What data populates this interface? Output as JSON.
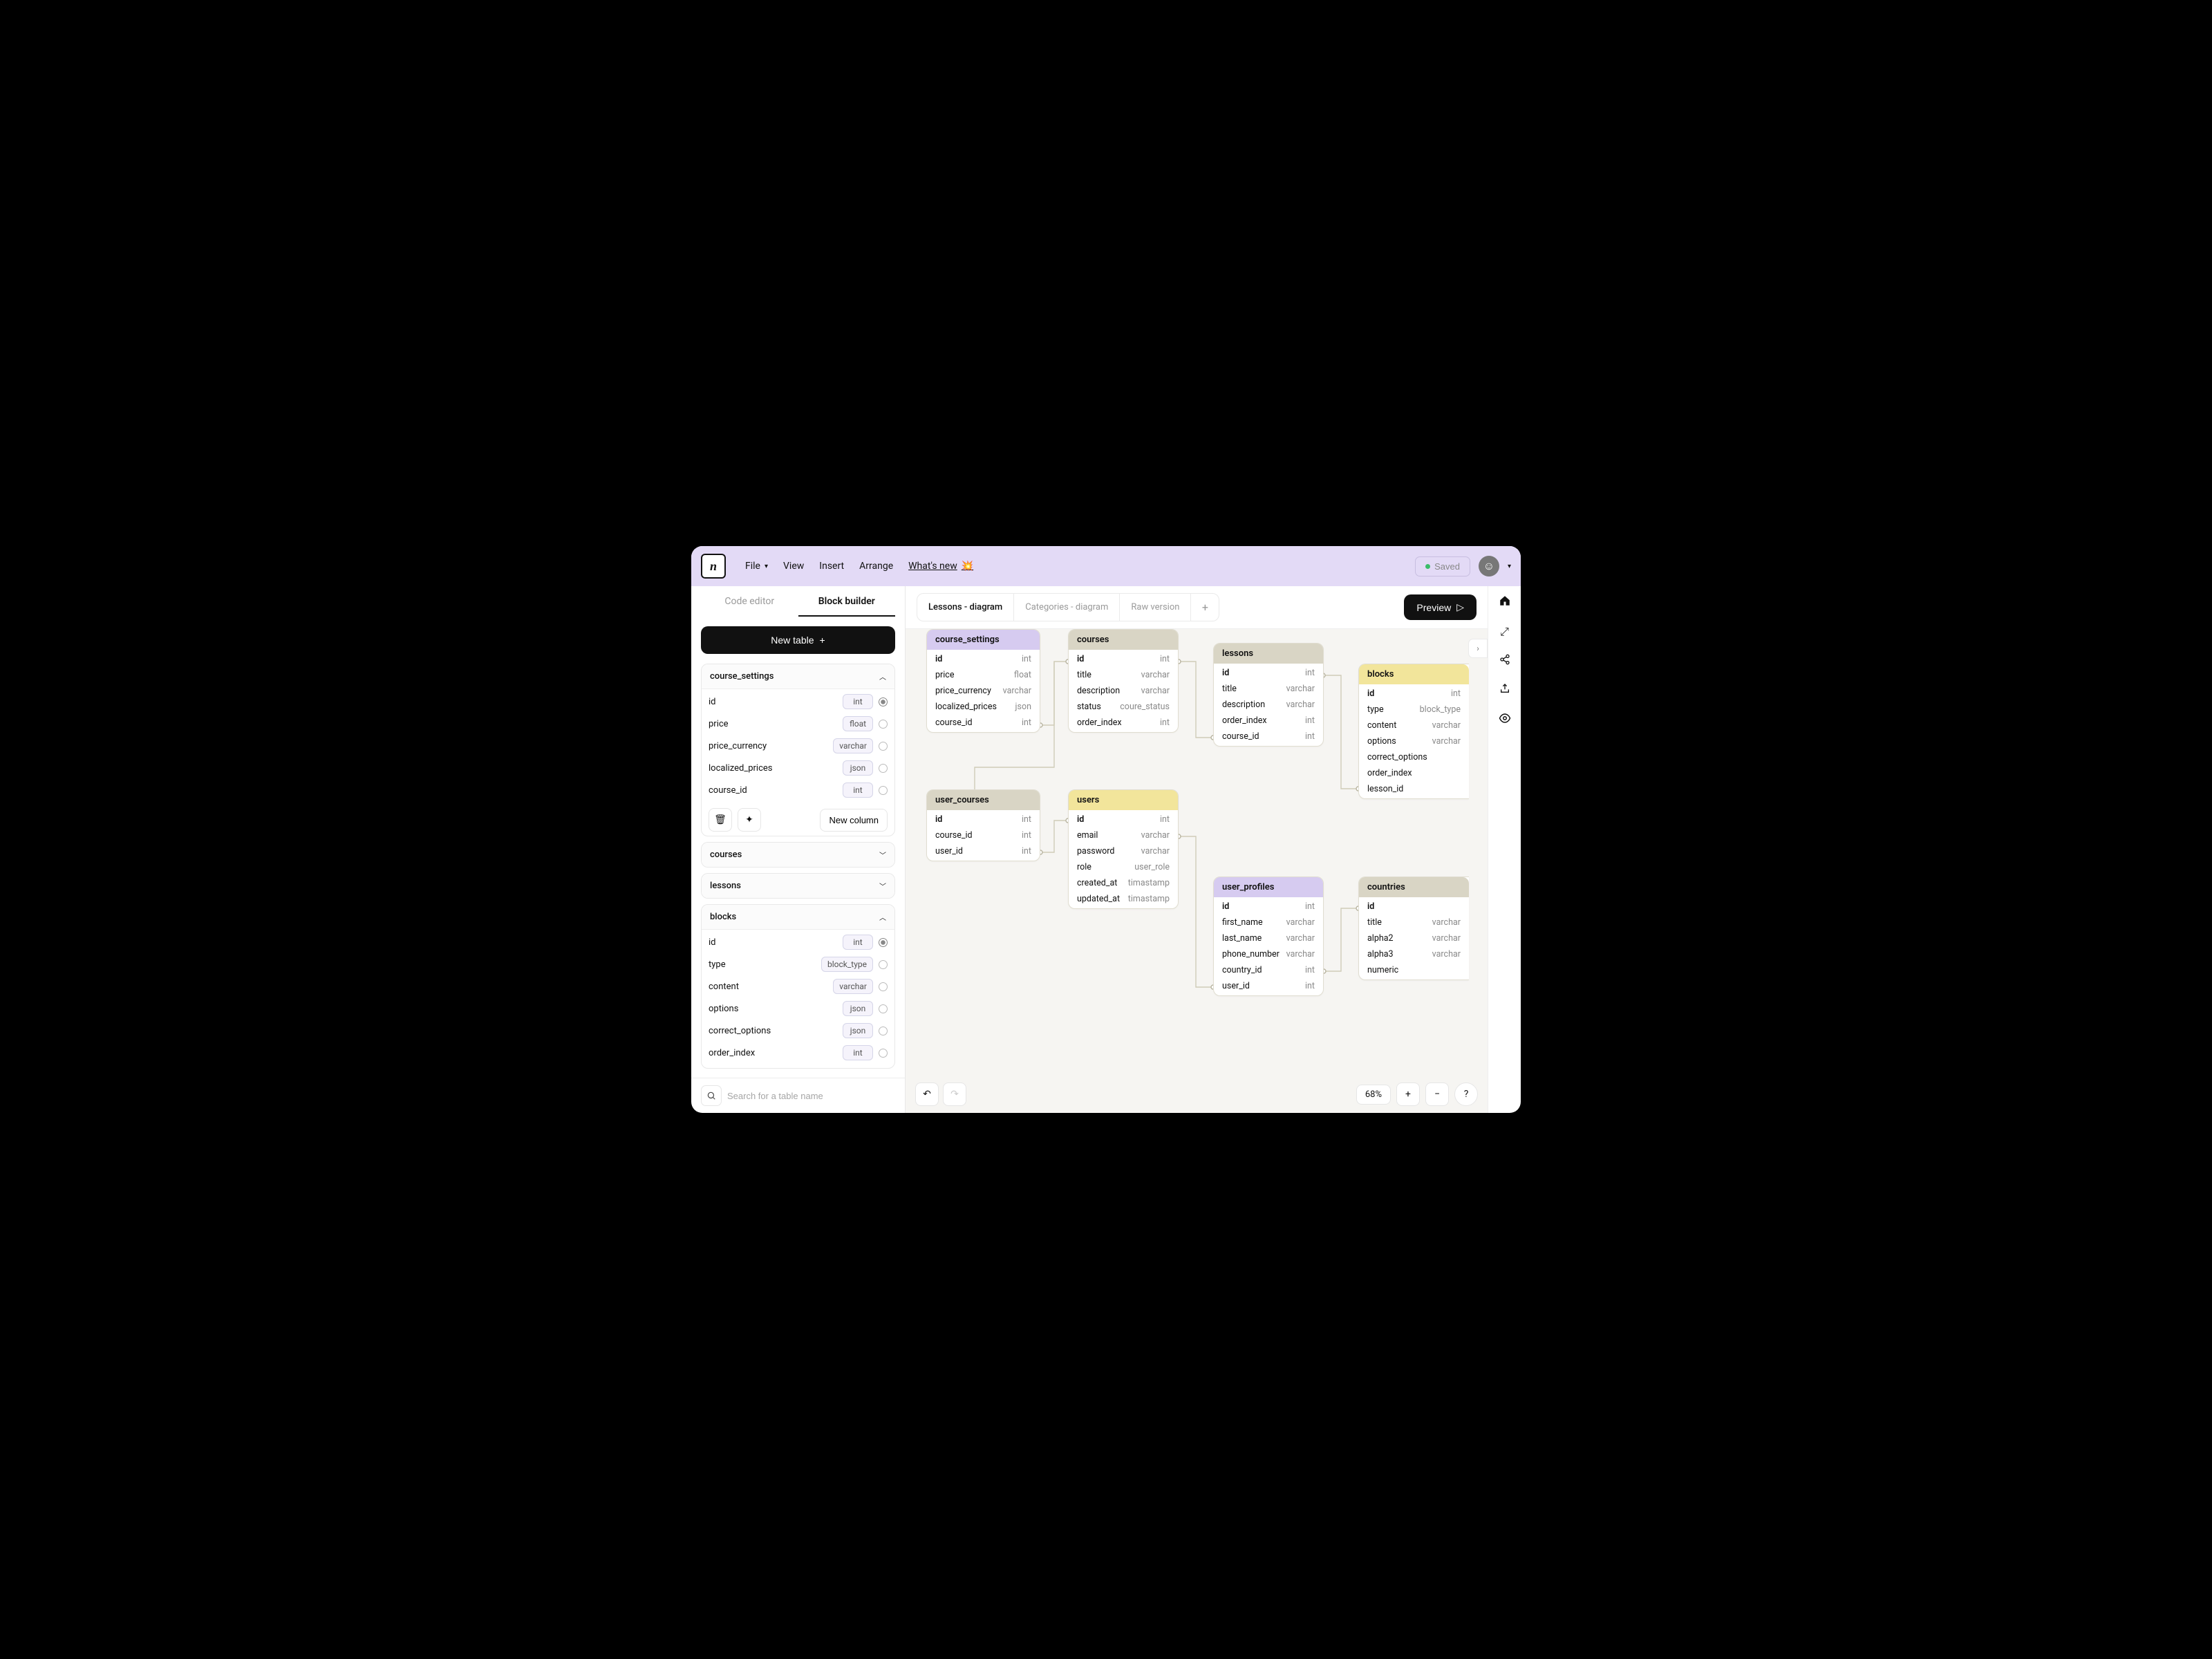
{
  "menu": {
    "file": "File",
    "view": "View",
    "insert": "Insert",
    "arrange": "Arrange",
    "whatsnew": "What's new"
  },
  "saved": "Saved",
  "sidebar": {
    "tabs": {
      "code": "Code editor",
      "block": "Block builder"
    },
    "new_table": "New table",
    "search_placeholder": "Search for a table name",
    "new_column": "New column",
    "accordions": [
      {
        "name": "course_settings",
        "open": true,
        "cols": [
          {
            "n": "id",
            "t": "int",
            "pk": true
          },
          {
            "n": "price",
            "t": "float",
            "pk": false
          },
          {
            "n": "price_currency",
            "t": "varchar",
            "pk": false
          },
          {
            "n": "localized_prices",
            "t": "json",
            "pk": false
          },
          {
            "n": "course_id",
            "t": "int",
            "pk": false
          }
        ]
      },
      {
        "name": "courses",
        "open": false
      },
      {
        "name": "lessons",
        "open": false
      },
      {
        "name": "blocks",
        "open": true,
        "cols": [
          {
            "n": "id",
            "t": "int",
            "pk": true
          },
          {
            "n": "type",
            "t": "block_type",
            "pk": false
          },
          {
            "n": "content",
            "t": "varchar",
            "pk": false
          },
          {
            "n": "options",
            "t": "json",
            "pk": false
          },
          {
            "n": "correct_options",
            "t": "json",
            "pk": false
          },
          {
            "n": "order_index",
            "t": "int",
            "pk": false
          }
        ]
      }
    ]
  },
  "canvas": {
    "tabs": [
      "Lessons - diagram",
      "Categories - diagram",
      "Raw version"
    ],
    "preview": "Preview",
    "zoom": "68%",
    "help": "?",
    "tables": {
      "course_settings": {
        "title": "course_settings",
        "cols": [
          {
            "n": "id",
            "t": "int",
            "pk": true
          },
          {
            "n": "price",
            "t": "float"
          },
          {
            "n": "price_currency",
            "t": "varchar"
          },
          {
            "n": "localized_prices",
            "t": "json"
          },
          {
            "n": "course_id",
            "t": "int"
          }
        ]
      },
      "courses": {
        "title": "courses",
        "cols": [
          {
            "n": "id",
            "t": "int",
            "pk": true
          },
          {
            "n": "title",
            "t": "varchar"
          },
          {
            "n": "description",
            "t": "varchar"
          },
          {
            "n": "status",
            "t": "coure_status"
          },
          {
            "n": "order_index",
            "t": "int"
          }
        ]
      },
      "lessons": {
        "title": "lessons",
        "cols": [
          {
            "n": "id",
            "t": "int",
            "pk": true
          },
          {
            "n": "title",
            "t": "varchar"
          },
          {
            "n": "description",
            "t": "varchar"
          },
          {
            "n": "order_index",
            "t": "int"
          },
          {
            "n": "course_id",
            "t": "int"
          }
        ]
      },
      "blocks": {
        "title": "blocks",
        "cols": [
          {
            "n": "id",
            "t": "int",
            "pk": true
          },
          {
            "n": "type",
            "t": "block_type"
          },
          {
            "n": "content",
            "t": "varchar"
          },
          {
            "n": "options",
            "t": "varchar"
          },
          {
            "n": "correct_options",
            "t": ""
          },
          {
            "n": "order_index",
            "t": ""
          },
          {
            "n": "lesson_id",
            "t": ""
          }
        ]
      },
      "user_courses": {
        "title": "user_courses",
        "cols": [
          {
            "n": "id",
            "t": "int",
            "pk": true
          },
          {
            "n": "course_id",
            "t": "int"
          },
          {
            "n": "user_id",
            "t": "int"
          }
        ]
      },
      "users": {
        "title": "users",
        "cols": [
          {
            "n": "id",
            "t": "int",
            "pk": true
          },
          {
            "n": "email",
            "t": "varchar"
          },
          {
            "n": "password",
            "t": "varchar"
          },
          {
            "n": "role",
            "t": "user_role"
          },
          {
            "n": "created_at",
            "t": "timastamp"
          },
          {
            "n": "updated_at",
            "t": "timastamp"
          }
        ]
      },
      "user_profiles": {
        "title": "user_profiles",
        "cols": [
          {
            "n": "id",
            "t": "int",
            "pk": true
          },
          {
            "n": "first_name",
            "t": "varchar"
          },
          {
            "n": "last_name",
            "t": "varchar"
          },
          {
            "n": "phone_number",
            "t": "varchar"
          },
          {
            "n": "country_id",
            "t": "int"
          },
          {
            "n": "user_id",
            "t": "int"
          }
        ]
      },
      "countries": {
        "title": "countries",
        "cols": [
          {
            "n": "id",
            "t": "",
            "pk": true
          },
          {
            "n": "title",
            "t": "varchar"
          },
          {
            "n": "alpha2",
            "t": "varchar"
          },
          {
            "n": "alpha3",
            "t": "varchar"
          },
          {
            "n": "numeric",
            "t": ""
          }
        ]
      }
    }
  }
}
